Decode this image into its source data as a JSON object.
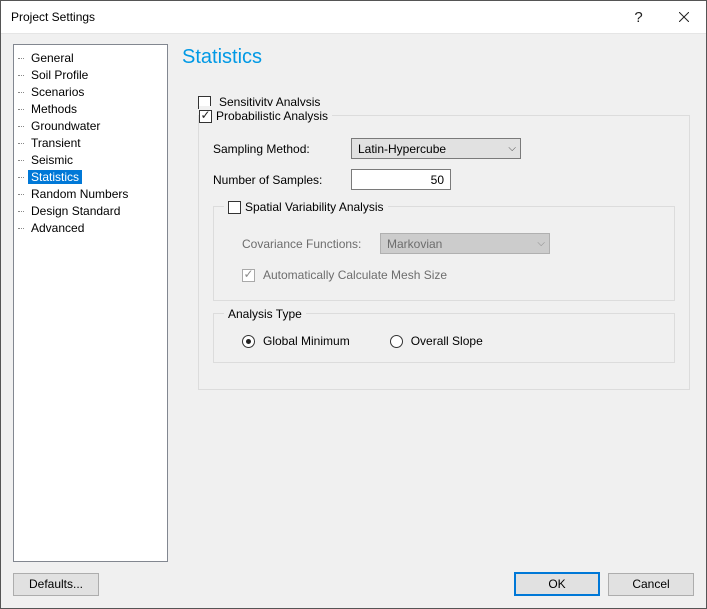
{
  "window": {
    "title": "Project Settings"
  },
  "tree": {
    "items": [
      "General",
      "Soil Profile",
      "Scenarios",
      "Methods",
      "Groundwater",
      "Transient",
      "Seismic",
      "Statistics",
      "Random Numbers",
      "Design Standard",
      "Advanced"
    ],
    "selected_index": 7
  },
  "page": {
    "heading": "Statistics",
    "sensitivity": {
      "label": "Sensitivity Analysis",
      "checked": false
    },
    "probabilistic": {
      "label": "Probabilistic Analysis",
      "checked": true,
      "sampling_method_label": "Sampling Method:",
      "sampling_method_value": "Latin-Hypercube",
      "num_samples_label": "Number of Samples:",
      "num_samples_value": "50",
      "spatial": {
        "label": "Spatial Variability Analysis",
        "checked": false,
        "covariance_label": "Covariance Functions:",
        "covariance_value": "Markovian",
        "auto_mesh_label": "Automatically Calculate Mesh Size",
        "auto_mesh_checked": true
      },
      "analysis_type": {
        "legend": "Analysis Type",
        "option1": "Global Minimum",
        "option2": "Overall Slope",
        "selected": "option1"
      }
    }
  },
  "footer": {
    "defaults": "Defaults...",
    "ok": "OK",
    "cancel": "Cancel"
  }
}
